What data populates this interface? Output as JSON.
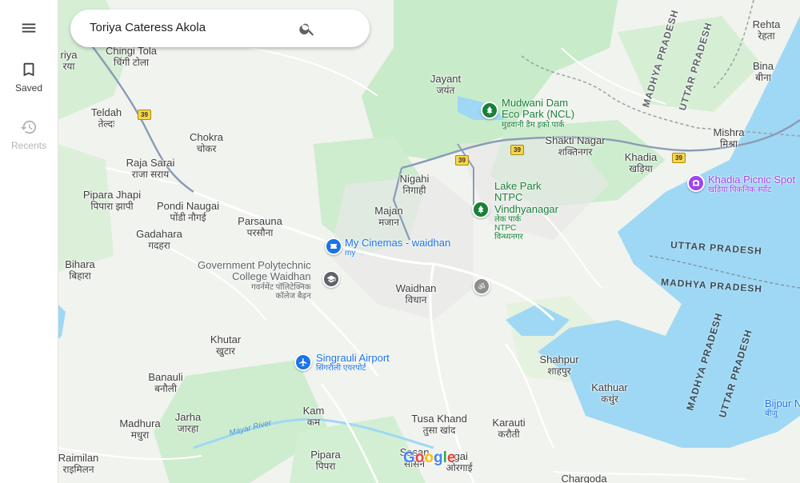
{
  "rail": {
    "saved_label": "Saved",
    "recents_label": "Recents"
  },
  "search": {
    "value": "Toriya Cateress Akola"
  },
  "places": [
    {
      "en": "Chingi Tola",
      "hi": "चिंगी टोला"
    },
    {
      "en": "Teldah",
      "hi": "तेल्दः"
    },
    {
      "en": "Chokra",
      "hi": "चोकर"
    },
    {
      "en": "Raja Sarai",
      "hi": "राजा सराय"
    },
    {
      "en": "Pipara Jhapi",
      "hi": "पिपारा झापी"
    },
    {
      "en": "Pondi Naugai",
      "hi": "पोंडी नौगई"
    },
    {
      "en": "Parsauna",
      "hi": "परसौना"
    },
    {
      "en": "Gadahara",
      "hi": "गदहरा"
    },
    {
      "en": "Bihara",
      "hi": "बिहारा"
    },
    {
      "en": "Jayant",
      "hi": "जयंत"
    },
    {
      "en": "Nigahi",
      "hi": "निगाही"
    },
    {
      "en": "Majan",
      "hi": "मजान"
    },
    {
      "en": "Waidhan",
      "hi": "विधान"
    },
    {
      "en": "Shakti Nagar",
      "hi": "शक्तिनगर"
    },
    {
      "en": "Khadia",
      "hi": "खड़िया"
    },
    {
      "en": "Mishra",
      "hi": "मिश्रा"
    },
    {
      "en": "Rehta",
      "hi": "रेहता"
    },
    {
      "en": "Bina",
      "hi": "बीना"
    },
    {
      "en": "Khutar",
      "hi": "खुटार"
    },
    {
      "en": "Banauli",
      "hi": "बनौली"
    },
    {
      "en": "Madhura",
      "hi": "मधुरा"
    },
    {
      "en": "Jarha",
      "hi": "जारहा"
    },
    {
      "en": "Kam",
      "hi": "कम"
    },
    {
      "en": "Tusa Khand",
      "hi": "तुसा खांद"
    },
    {
      "en": "Karauti",
      "hi": "करौती"
    },
    {
      "en": "Shahpur",
      "hi": "शाहपुर"
    },
    {
      "en": "Kathuar",
      "hi": "कथुंर"
    },
    {
      "en": "Raimilan",
      "hi": "राइमिलन"
    },
    {
      "en": "Pipara",
      "hi": "पिपरा"
    },
    {
      "en": "Chargoda",
      "hi": ""
    },
    {
      "en": "riya",
      "hi": "रया"
    },
    {
      "en": "Sasan",
      "hi": "सासन"
    },
    {
      "en": "rgai",
      "hi": "ओरगाई"
    }
  ],
  "pois": [
    {
      "en": "Mudwani Dam",
      "en2": "Eco Park (NCL)",
      "hi": "मुडवानी डैम इको पार्क",
      "color": "#188038",
      "icon": "tree-icon"
    },
    {
      "en": "Lake Park",
      "en2": "NTPC",
      "en3": "Vindhyanagar",
      "hi": "लेक पार्क",
      "hi2": "NTPC",
      "hi3": "विन्ध्यनगर",
      "color": "#188038",
      "icon": "tree-icon"
    },
    {
      "en": "My Cinemas - waidhan",
      "hi": "my",
      "color": "#1a73e8",
      "icon": "ticket-icon"
    },
    {
      "en": "Government Polytechnic",
      "en2": "College Waidhan",
      "hi": "गवर्नमेंट पॉलिटेक्निक",
      "hi2": "कॉलेज बैढ़न",
      "color": "#5f6368",
      "icon": "school-icon"
    },
    {
      "en": "Singrauli Airport",
      "hi": "सिंगरौली एयरपोर्ट",
      "color": "#1a73e8",
      "icon": "plane-icon"
    },
    {
      "en": "Khadia Picnic Spot",
      "hi": "खड़िया पिकनिक स्पॉट",
      "color": "#a142f4",
      "icon": "camera-icon"
    },
    {
      "en": "Bijpur N",
      "hi": "बीजु",
      "color": "#1a73e8",
      "icon": "pin-icon"
    }
  ],
  "states": [
    "MADHYA PRADESH",
    "UTTAR PRADESH",
    "UTTAR PRADESH",
    "MADHYA PRADESH",
    "MADHYA PRADESH",
    "UTTAR PRADESH"
  ],
  "shields": [
    "39",
    "39",
    "39",
    "39"
  ],
  "river": "Mayar River",
  "brand": "Google",
  "colors": {
    "land": "#f1f3ee",
    "forest": "#c8ebc9",
    "water": "#9fd8f4",
    "road": "#ffffff",
    "highway": "#8a9bb5",
    "state_border": "#9aa0a6"
  }
}
